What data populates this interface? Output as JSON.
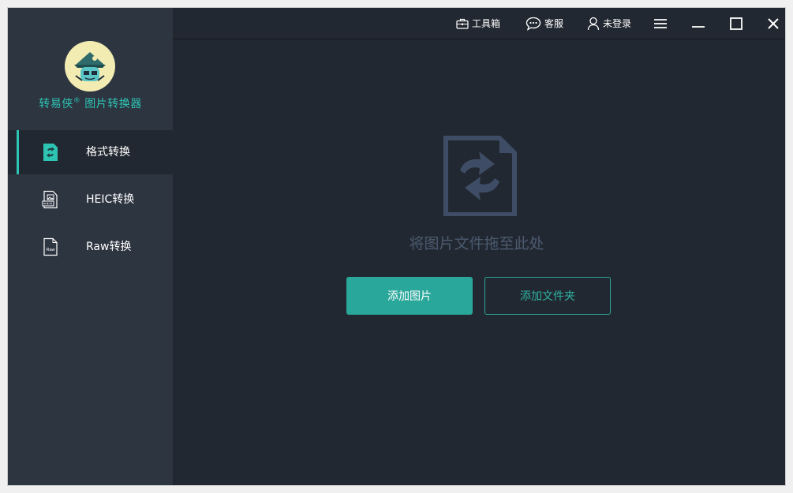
{
  "app": {
    "brand_name": "转易侠",
    "brand_mark": "®",
    "brand_suffix": " 图片转换器"
  },
  "sidebar": {
    "items": [
      {
        "label": "格式转换",
        "icon": "format-convert-icon",
        "active": true
      },
      {
        "label": "HEIC转换",
        "icon": "heic-file-icon",
        "active": false
      },
      {
        "label": "Raw转换",
        "icon": "raw-file-icon",
        "active": false
      }
    ],
    "raw_icon_text": "Raw"
  },
  "topbar": {
    "toolbox_label": "工具箱",
    "service_label": "客服",
    "login_label": "未登录"
  },
  "main": {
    "drop_hint": "将图片文件拖至此处",
    "add_images_label": "添加图片",
    "add_folder_label": "添加文件夹"
  },
  "colors": {
    "accent": "#2ec4b4",
    "button_primary": "#29a79a",
    "sidebar_bg": "#2d3541",
    "main_bg": "#222831",
    "drop_icon": "#3e4d65",
    "drop_text": "#4b5a6f"
  }
}
